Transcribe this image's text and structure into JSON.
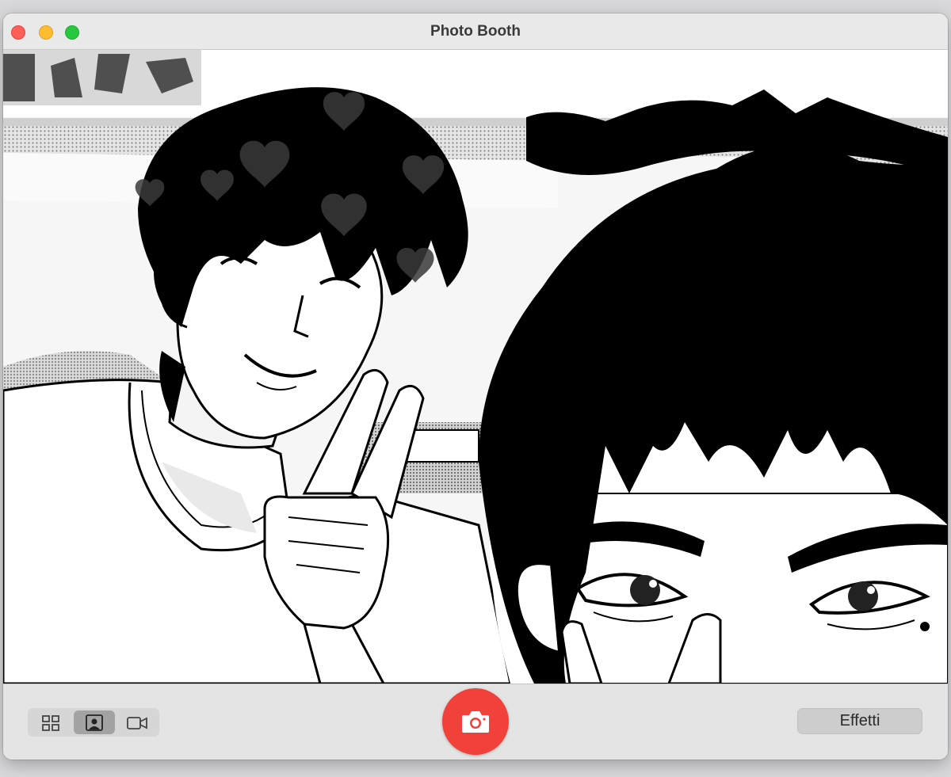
{
  "window": {
    "title": "Photo Booth"
  },
  "traffic_lights": {
    "close": "close-button",
    "minimize": "minimize-button",
    "zoom": "zoom-button"
  },
  "preview": {
    "effect_overlay": "hearts",
    "mode": "black-and-white manga"
  },
  "toolbar": {
    "view_modes": [
      {
        "icon": "grid-icon",
        "selected": false
      },
      {
        "icon": "single-photo-icon",
        "selected": true
      },
      {
        "icon": "video-camera-icon",
        "selected": false
      }
    ],
    "shutter_icon": "camera-icon",
    "effects_label": "Effetti"
  },
  "colors": {
    "shutter": "#f2403a",
    "close": "#fe5f57",
    "minimize": "#febc2e",
    "zoom": "#28c840"
  }
}
